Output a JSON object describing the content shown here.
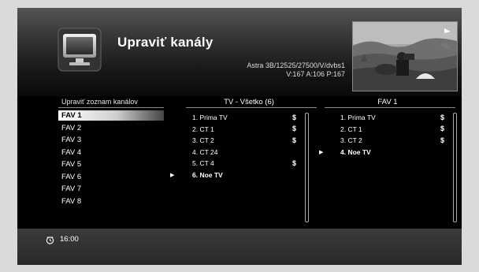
{
  "header": {
    "title": "Upraviť kanály",
    "sat_line1": "Astra 3B/12525/27500/V/dvbs1",
    "sat_line2": "V:167  A:106  P:167"
  },
  "fav_list": {
    "title": "Upraviť zoznam kanálov",
    "items": [
      "FAV 1",
      "FAV 2",
      "FAV 3",
      "FAV 4",
      "FAV 5",
      "FAV 6",
      "FAV 7",
      "FAV 8"
    ],
    "selected_index": 0
  },
  "tv_list": {
    "title": "TV - Všetko (6)",
    "channels": [
      {
        "label": "1. Prima TV",
        "scrambled": "$"
      },
      {
        "label": "2. CT 1",
        "scrambled": "$"
      },
      {
        "label": "3. CT 2",
        "scrambled": "$"
      },
      {
        "label": "4. CT 24",
        "scrambled": ""
      },
      {
        "label": "5. CT 4",
        "scrambled": "$"
      },
      {
        "label": "6. Noe TV",
        "scrambled": ""
      }
    ],
    "cursor_index": 5
  },
  "fav_channels": {
    "title": "FAV 1",
    "channels": [
      {
        "label": "1. Prima TV",
        "scrambled": "$"
      },
      {
        "label": "2. CT 1",
        "scrambled": "$"
      },
      {
        "label": "3. CT 2",
        "scrambled": "$"
      },
      {
        "label": "4. Noe TV",
        "scrambled": ""
      }
    ],
    "cursor_index": 3
  },
  "footer": {
    "time": "16:00"
  },
  "icons": {
    "header_logo": "tv-icon",
    "preview": "video-preview",
    "cursor": "play-arrow-icon",
    "footer": "clock-icon"
  }
}
